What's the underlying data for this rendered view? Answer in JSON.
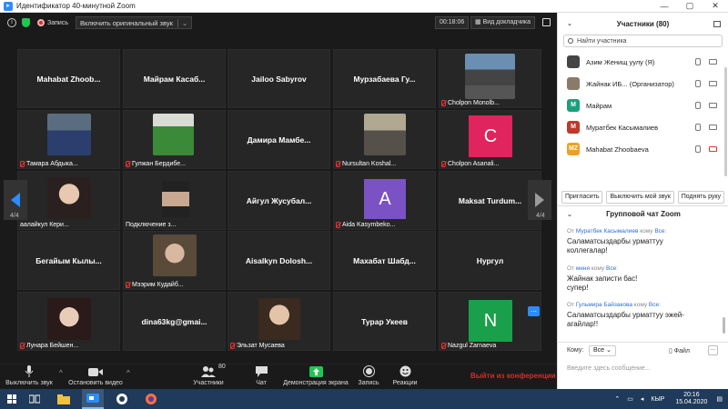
{
  "window": {
    "title": "Идентификатор 40-минутной Zoom",
    "min": "—",
    "max": "▢",
    "close": "✕"
  },
  "topbar": {
    "record_label": "Запись",
    "audio_label": "Включить оригинальный звук",
    "audio_caret": "⌄",
    "timer": "00:18:06",
    "view_label": "Вид докладчика"
  },
  "tiles": [
    {
      "name": "Mahabat Zhoob...",
      "label": ""
    },
    {
      "name": "Майрам Касаб...",
      "label": ""
    },
    {
      "name": "Jailoo Sabyrov",
      "label": ""
    },
    {
      "name": "Мурзабаева Гу...",
      "label": ""
    },
    {
      "name": "",
      "label": "Cholpon Monolb..."
    },
    {
      "name": "",
      "label": "Тамара Абдыка..."
    },
    {
      "name": "",
      "label": "Гулжан Бердибе..."
    },
    {
      "name": "Дамира Мамбе...",
      "label": ""
    },
    {
      "name": "",
      "label": "Nursultan Koshal..."
    },
    {
      "name": "",
      "label": "Cholpon Asanali..."
    },
    {
      "name": "",
      "label": "аалайкул Кери..."
    },
    {
      "name": "",
      "label": "Подключение з..."
    },
    {
      "name": "Айгул Жусубал...",
      "label": ""
    },
    {
      "name": "",
      "label": "Aida Kasymbeko..."
    },
    {
      "name": "Maksat Turdum...",
      "label": ""
    },
    {
      "name": "Бегайым Кылы...",
      "label": ""
    },
    {
      "name": "",
      "label": "Мээрим Кудайб..."
    },
    {
      "name": "Aisalkyn Dolosh...",
      "label": ""
    },
    {
      "name": "Махабат Шабд...",
      "label": ""
    },
    {
      "name": "Нургул",
      "label": ""
    },
    {
      "name": "",
      "label": "Лунара Бейшен..."
    },
    {
      "name": "dina63kg@gmai...",
      "label": ""
    },
    {
      "name": "",
      "label": "Эльзат Мусаева"
    },
    {
      "name": "Турар Укеев",
      "label": ""
    },
    {
      "name": "",
      "label": "Nazgul Zarnaeva"
    }
  ],
  "avatars": {
    "cholpon_asanali": "C",
    "aida": "A",
    "nazgul": "N"
  },
  "pages": {
    "left": "4/4",
    "right": "4/4"
  },
  "tile_more": "...",
  "toolbar": {
    "mute": "Выключить звук",
    "video": "Остановить видео",
    "participants": "Участники",
    "participants_count": "80",
    "chat": "Чат",
    "share": "Демонстрация экрана",
    "record": "Запись",
    "reactions": "Реакции",
    "end": "Выйти из конференции",
    "caret": "^"
  },
  "panel": {
    "title": "Участники (80)",
    "search_placeholder": "Найти участника",
    "participants": [
      {
        "name": "Азим Женищ уулу (Я)",
        "initials": "",
        "color": "#444"
      },
      {
        "name": "Жайнак ИБ... (Организатор)",
        "initials": "",
        "color": "#8a7a6a"
      },
      {
        "name": "Майрам",
        "initials": "M",
        "color": "#1aa07a"
      },
      {
        "name": "Муратбек Касымалиев",
        "initials": "M",
        "color": "#c0392b"
      },
      {
        "name": "Mahabat Zhoobaeva",
        "initials": "MZ",
        "color": "#f0a020"
      }
    ],
    "buttons": [
      "Пригласить",
      "Выключить мой звук",
      "Поднять руку"
    ]
  },
  "chat": {
    "title": "Групповой чат Zoom",
    "messages": [
      {
        "from_prefix": "От ",
        "from": "Муратбек Касымалиев",
        "to_prefix": " кому ",
        "to": "Все",
        "colon": ":",
        "text1": "Саламатсыздарбы урматтуу",
        "text2": "коллегалар!"
      },
      {
        "from_prefix": "От ",
        "from": "меня",
        "to_prefix": " кому ",
        "to": "Все",
        "colon": ":",
        "text1": "Жайнак записти бас!",
        "text2": "супер!"
      },
      {
        "from_prefix": "От ",
        "from": "Гульмира Байзакова",
        "to_prefix": " кому ",
        "to": "Все",
        "colon": ":",
        "text1": "Саламатсыздарбы урматтуу эжей-",
        "text2": "агайлар!!"
      }
    ],
    "to_label": "Кому:",
    "to_value": "Все",
    "file_label": "Файл",
    "input_placeholder": "Введите здесь сообщение..."
  },
  "taskbar": {
    "lang": "КЫР",
    "time": "20:16",
    "date": "15.04.2020"
  },
  "colors": {
    "accent": "#2d8cff",
    "danger": "#e02828",
    "green": "#23c552"
  }
}
